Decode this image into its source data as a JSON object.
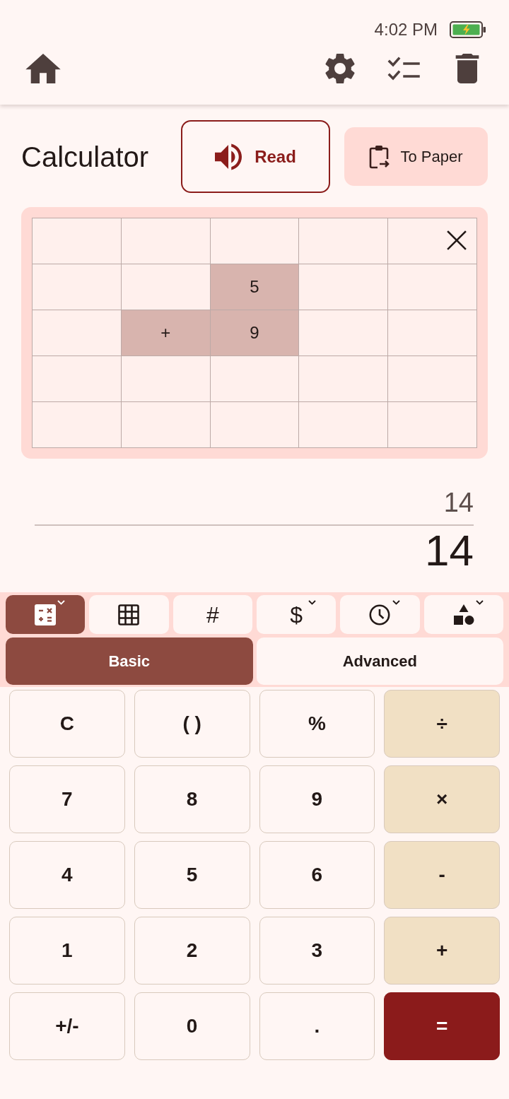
{
  "status_bar": {
    "time": "4:02 PM"
  },
  "title": "Calculator",
  "actions": [
    {
      "label": "Read",
      "kind": "outlined"
    },
    {
      "label": "To Paper",
      "kind": "tonal"
    }
  ],
  "paper_grid": {
    "rows": [
      [
        {
          "highlighted": false
        },
        {
          "highlighted": false
        },
        {
          "highlighted": false
        },
        {
          "highlighted": false
        },
        {
          "highlighted": false
        }
      ],
      [
        {
          "highlighted": false
        },
        {
          "highlighted": false
        },
        {
          "text": "5",
          "highlighted": true
        },
        {
          "highlighted": false
        },
        {
          "highlighted": false
        }
      ],
      [
        {
          "highlighted": false
        },
        {
          "text": "+",
          "highlighted": true
        },
        {
          "text": "9",
          "highlighted": true
        },
        {
          "highlighted": false
        },
        {
          "highlighted": false
        }
      ],
      [
        {
          "highlighted": false
        },
        {
          "highlighted": false
        },
        {
          "highlighted": false
        },
        {
          "highlighted": false
        },
        {
          "highlighted": false
        }
      ],
      [
        {
          "highlighted": false
        },
        {
          "highlighted": false
        },
        {
          "highlighted": false
        },
        {
          "highlighted": false
        },
        {
          "highlighted": false
        }
      ]
    ]
  },
  "display": {
    "preview": "14",
    "result": "14"
  },
  "category_tabs": [
    {
      "selected": true,
      "has_menu": true
    },
    {
      "selected": false,
      "has_menu": false
    },
    {
      "selected": false,
      "has_menu": false,
      "symbol": "#"
    },
    {
      "selected": false,
      "has_menu": true,
      "symbol": "$"
    },
    {
      "selected": false,
      "has_menu": true
    },
    {
      "selected": false,
      "has_menu": true
    }
  ],
  "mode_tabs": [
    {
      "label": "Basic",
      "selected": true
    },
    {
      "label": "Advanced",
      "selected": false
    }
  ],
  "keypad": [
    [
      {
        "label": "C",
        "kind": "plain"
      },
      {
        "label": "( )",
        "kind": "plain"
      },
      {
        "label": "%",
        "kind": "plain"
      },
      {
        "label": "÷",
        "kind": "operator"
      }
    ],
    [
      {
        "label": "7",
        "kind": "plain"
      },
      {
        "label": "8",
        "kind": "plain"
      },
      {
        "label": "9",
        "kind": "plain"
      },
      {
        "label": "×",
        "kind": "operator"
      }
    ],
    [
      {
        "label": "4",
        "kind": "plain"
      },
      {
        "label": "5",
        "kind": "plain"
      },
      {
        "label": "6",
        "kind": "plain"
      },
      {
        "label": "-",
        "kind": "operator"
      }
    ],
    [
      {
        "label": "1",
        "kind": "plain"
      },
      {
        "label": "2",
        "kind": "plain"
      },
      {
        "label": "3",
        "kind": "plain"
      },
      {
        "label": "+",
        "kind": "operator"
      }
    ],
    [
      {
        "label": "+/-",
        "kind": "plain"
      },
      {
        "label": "0",
        "kind": "plain"
      },
      {
        "label": ".",
        "kind": "plain"
      },
      {
        "label": "=",
        "kind": "accent"
      }
    ]
  ]
}
